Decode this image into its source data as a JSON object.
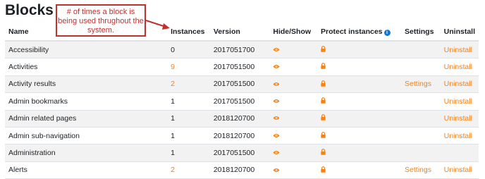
{
  "page": {
    "title": "Blocks"
  },
  "annotation": {
    "text": "# of  times a block is being used thrughout the system."
  },
  "table": {
    "headers": {
      "name": "Name",
      "instances": "Instances",
      "version": "Version",
      "hide_show": "Hide/Show",
      "protect": "Protect instances",
      "settings": "Settings",
      "uninstall": "Uninstall"
    },
    "rows": [
      {
        "name": "Accessibility",
        "instances": "0",
        "version": "2017051700",
        "settings": "",
        "uninstall": "Uninstall"
      },
      {
        "name": "Activities",
        "instances": "9",
        "version": "2017051500",
        "settings": "",
        "uninstall": "Uninstall"
      },
      {
        "name": "Activity results",
        "instances": "2",
        "version": "2017051500",
        "settings": "Settings",
        "uninstall": "Uninstall"
      },
      {
        "name": "Admin bookmarks",
        "instances": "1",
        "version": "2017051500",
        "settings": "",
        "uninstall": "Uninstall"
      },
      {
        "name": "Admin related pages",
        "instances": "1",
        "version": "2018120700",
        "settings": "",
        "uninstall": "Uninstall"
      },
      {
        "name": "Admin sub-navigation",
        "instances": "1",
        "version": "2018120700",
        "settings": "",
        "uninstall": "Uninstall"
      },
      {
        "name": "Administration",
        "instances": "1",
        "version": "2017051500",
        "settings": "",
        "uninstall": ""
      },
      {
        "name": "Alerts",
        "instances": "2",
        "version": "2018120700",
        "settings": "Settings",
        "uninstall": "Uninstall"
      }
    ]
  },
  "icons": {
    "hide_show": "eye-icon",
    "protect": "lock-icon",
    "info": "info-icon"
  },
  "colors": {
    "link": "#f98012",
    "annotation": "#c0302f",
    "info": "#1177d1",
    "icon": "#f98012"
  }
}
